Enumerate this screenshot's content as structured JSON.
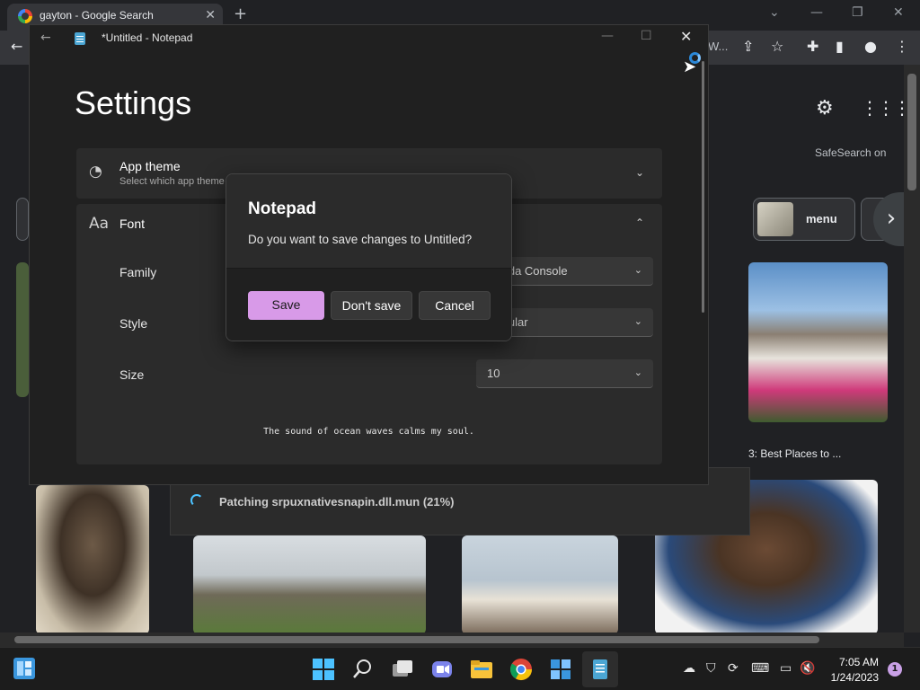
{
  "browser": {
    "tab_title": "gayton - Google Search",
    "omnibox_partial": "W...",
    "safesearch": "SafeSearch on",
    "chip_menu": "menu",
    "result_caption": "3: Best Places to ..."
  },
  "progress": {
    "text": "Patching srpuxnativesnapin.dll.mun (21%)",
    "percent": 21
  },
  "notepad": {
    "title": "*Untitled - Notepad",
    "settings_title": "Settings",
    "app_theme": {
      "label": "App theme",
      "sub": "Select which app theme"
    },
    "font": {
      "label": "Font",
      "family_label": "Family",
      "family_value": "Lucida Console",
      "style_label": "Style",
      "style_value": "Regular",
      "size_label": "Size",
      "size_value": "10"
    },
    "preview": "The sound of ocean waves calms my soul."
  },
  "dialog": {
    "title": "Notepad",
    "message": "Do you want to save changes to Untitled?",
    "save": "Save",
    "dont_save": "Don't save",
    "cancel": "Cancel"
  },
  "taskbar": {
    "time": "7:05 AM",
    "date": "1/24/2023",
    "notifications": "1"
  },
  "colors": {
    "accent": "#d89ae8",
    "dialog_bg": "#2b2b2b",
    "notepad_bg": "#202020",
    "browser_bg": "#202124"
  }
}
